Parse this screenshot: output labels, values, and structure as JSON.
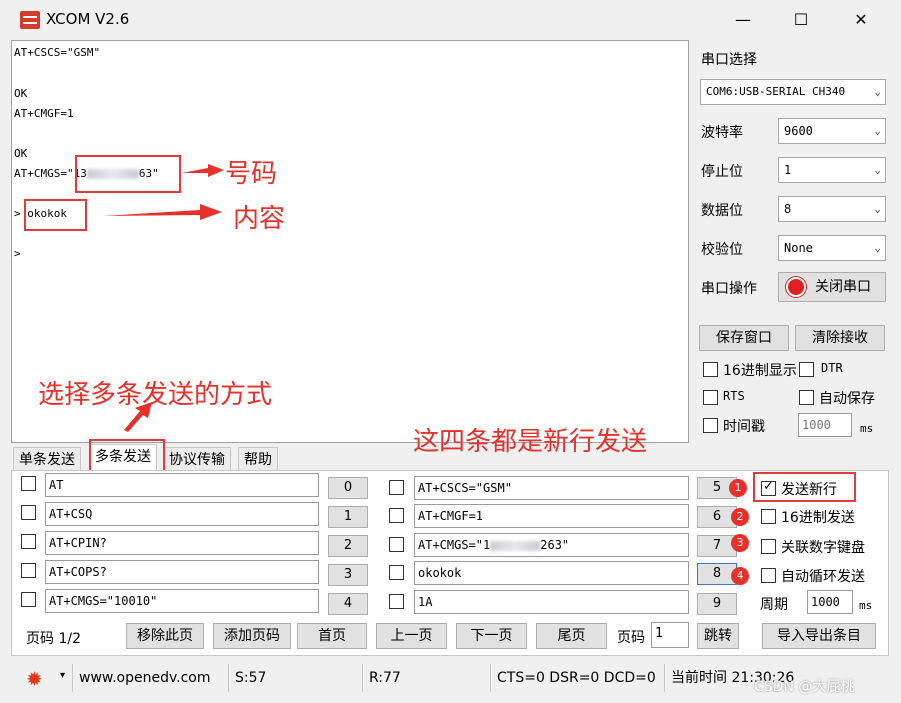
{
  "window": {
    "title": "XCOM V2.6",
    "minimize": "—",
    "maximize": "☐",
    "close": "✕"
  },
  "receive": {
    "lines": [
      "AT+CSCS=\"GSM\"",
      "OK",
      "AT+CMGF=1",
      "OK",
      "AT+CMGS=\"13",
      "63\"",
      "> okokok",
      ">"
    ]
  },
  "annotations": {
    "number": "号码",
    "content": "内容",
    "method": "选择多条发送的方式",
    "four_newline": "这四条都是新行发送"
  },
  "serial": {
    "port_label": "串口选择",
    "port_value": "COM6:USB-SERIAL CH340",
    "baud_label": "波特率",
    "baud_value": "9600",
    "stop_label": "停止位",
    "stop_value": "1",
    "data_label": "数据位",
    "data_value": "8",
    "parity_label": "校验位",
    "parity_value": "None",
    "op_label": "串口操作",
    "close_port": "关闭串口",
    "save_window": "保存窗口",
    "clear_recv": "清除接收",
    "hex_display": "16进制显示",
    "dtr": "DTR",
    "rts": "RTS",
    "auto_save": "自动保存",
    "timestamp": "时间戳",
    "timestamp_value": "1000",
    "ms": "ms"
  },
  "tabs": [
    "单条发送",
    "多条发送",
    "协议传输",
    "帮助"
  ],
  "multi": {
    "left": [
      {
        "text": "AT",
        "num": "0"
      },
      {
        "text": "AT+CSQ",
        "num": "1"
      },
      {
        "text": "AT+CPIN?",
        "num": "2"
      },
      {
        "text": "AT+COPS?",
        "num": "3"
      },
      {
        "text": "AT+CMGS=\"10010\"",
        "num": "4"
      }
    ],
    "right": [
      {
        "text": "AT+CSCS=\"GSM\"",
        "num": "5"
      },
      {
        "text": "AT+CMGF=1",
        "num": "6"
      },
      {
        "text": "AT+CMGS=\"1",
        "tail": "263\"",
        "num": "7"
      },
      {
        "text": "okokok",
        "num": "8"
      },
      {
        "text": "1A",
        "num": "9"
      }
    ],
    "badges": [
      "1",
      "2",
      "3",
      "4"
    ],
    "send_newline": "发送新行",
    "hex_send": "16进制发送",
    "link_keypad": "关联数字键盘",
    "auto_loop": "自动循环发送",
    "period_label": "周期",
    "period_value": "1000",
    "ms": "ms",
    "page_label": "页码",
    "page_value": "1/2",
    "remove_page": "移除此页",
    "add_page": "添加页码",
    "first": "首页",
    "prev": "上一页",
    "next": "下一页",
    "last": "尾页",
    "page_input_label": "页码",
    "page_input": "1",
    "jump": "跳转",
    "import_export": "导入导出条目"
  },
  "status": {
    "website": "www.openedv.com",
    "sent": "S:57",
    "received": "R:77",
    "lines": "CTS=0 DSR=0 DCD=0",
    "time": "当前时间 21:30:26",
    "watermark": "CSDN @大屁桃"
  }
}
